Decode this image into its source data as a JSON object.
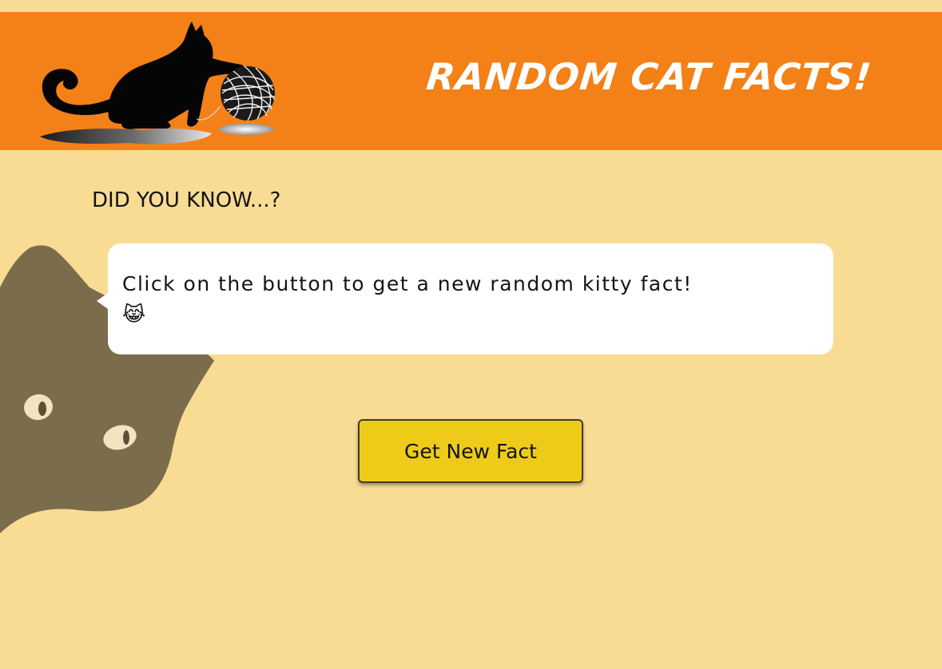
{
  "header": {
    "title": "RANDOM CAT FACTS!"
  },
  "main": {
    "heading": "DID YOU KNOW...?",
    "fact_text": "Click on the button to get a new random kitty fact!",
    "fact_emoji": "😹",
    "button_label": "Get New Fact"
  },
  "colors": {
    "background": "#f9dc94",
    "header": "#f38117",
    "button": "#eecb19",
    "bubble": "#ffffff",
    "peek_cat": "#7b6c4b"
  },
  "icons": {
    "logo": "cat-playing-with-yarn-logo",
    "decor": "peeking-cat-illustration"
  }
}
